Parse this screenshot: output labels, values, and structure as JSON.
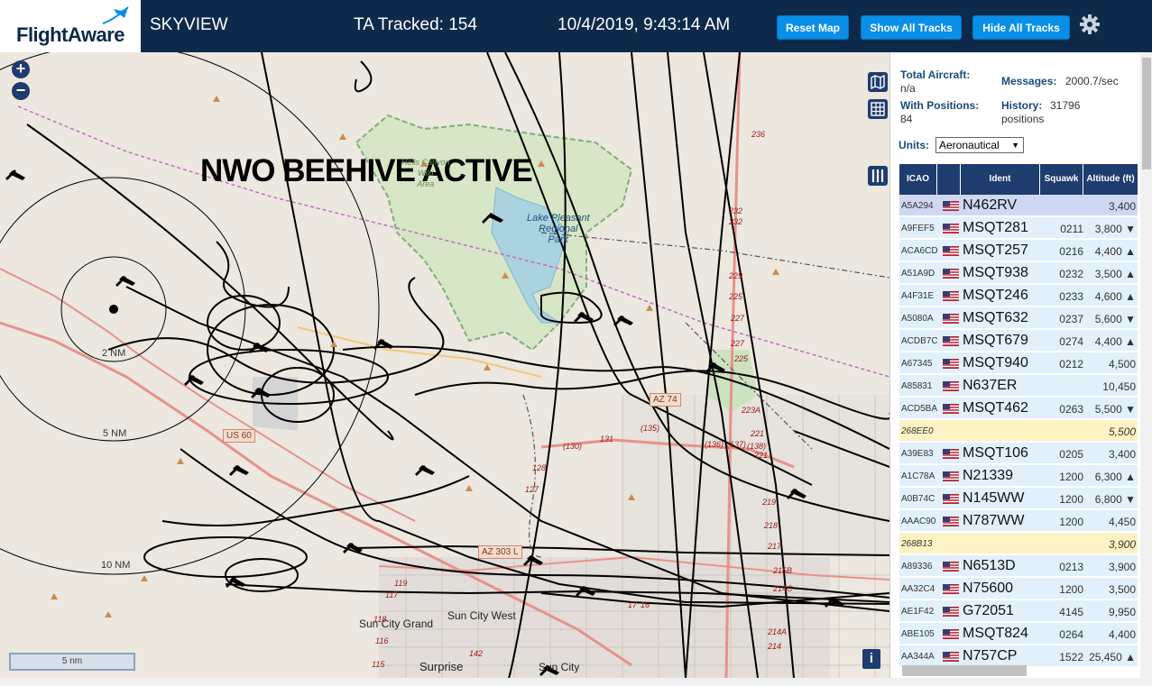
{
  "header": {
    "logo": "FlightAware",
    "app_name": "SKYVIEW",
    "tracked": "TA Tracked: 154",
    "datetime": "10/4/2019, 9:43:14 AM",
    "reset_map": "Reset Map",
    "show_all_tracks": "Show All Tracks",
    "hide_all_tracks": "Hide All Tracks"
  },
  "map": {
    "overlay_title": "NWO BEEHIVE ACTIVE",
    "ring_labels": [
      "2 NM",
      "5 NM",
      "10 NM"
    ],
    "scale_label": "5 nm",
    "lake": "Lake Pleasant\nRegional\nPark",
    "wildlife": "Hells Canyon\nWild\nArea",
    "towns": {
      "sun_city_grand": "Sun City Grand",
      "sun_city_west": "Sun City West",
      "surprise": "Surprise",
      "sun_city": "Sun City"
    },
    "shields": {
      "us60": "US 60",
      "az74": "AZ 74",
      "az303": "AZ 303 L"
    },
    "route_numbers": [
      "236",
      "232",
      "232",
      "229",
      "225",
      "227",
      "227",
      "225",
      "223A",
      "221",
      "221",
      "219",
      "218",
      "217",
      "215B",
      "214C",
      "214A",
      "214",
      "(130)",
      "131",
      "(135)",
      "(136)",
      "(137)",
      "(138)",
      "128",
      "127",
      "119",
      "117",
      "116",
      "118",
      "115",
      "142",
      "17",
      "16"
    ],
    "info_label": "i"
  },
  "sidebar": {
    "total_aircraft_label": "Total Aircraft:",
    "total_aircraft_value": "n/a",
    "messages_label": "Messages:",
    "messages_value": "2000.7/sec",
    "with_positions_label": "With Positions:",
    "with_positions_value": "84",
    "history_label": "History:",
    "history_value": "31796",
    "history_unit": "positions",
    "units_label": "Units:",
    "units_value": "Aeronautical",
    "columns": [
      "ICAO",
      "",
      "Ident",
      "Squawk",
      "Altitude (ft)"
    ],
    "rows": [
      {
        "icao": "A5A294",
        "ident": "N462RV",
        "squawk": "",
        "alt": "3,400",
        "kind": "sel"
      },
      {
        "icao": "A9FEF5",
        "ident": "MSQT281",
        "squawk": "0211",
        "alt": "3,800 ▼",
        "kind": ""
      },
      {
        "icao": "ACA6CD",
        "ident": "MSQT257",
        "squawk": "0216",
        "alt": "4,400 ▲",
        "kind": ""
      },
      {
        "icao": "A51A9D",
        "ident": "MSQT938",
        "squawk": "0232",
        "alt": "3,500 ▲",
        "kind": ""
      },
      {
        "icao": "A4F31E",
        "ident": "MSQT246",
        "squawk": "0233",
        "alt": "4,600 ▲",
        "kind": ""
      },
      {
        "icao": "A5080A",
        "ident": "MSQT632",
        "squawk": "0237",
        "alt": "5,600 ▼",
        "kind": ""
      },
      {
        "icao": "ACDB7C",
        "ident": "MSQT679",
        "squawk": "0274",
        "alt": "4,400 ▲",
        "kind": ""
      },
      {
        "icao": "A67345",
        "ident": "MSQT940",
        "squawk": "0212",
        "alt": "4,500",
        "kind": ""
      },
      {
        "icao": "A85831",
        "ident": "N637ER",
        "squawk": "",
        "alt": "10,450",
        "kind": ""
      },
      {
        "icao": "ACD5BA",
        "ident": "MSQT462",
        "squawk": "0263",
        "alt": "5,500 ▼",
        "kind": ""
      },
      {
        "icao": "268EE0",
        "ident": "",
        "squawk": "",
        "alt": "5,500",
        "kind": "nopos"
      },
      {
        "icao": "A39E83",
        "ident": "MSQT106",
        "squawk": "0205",
        "alt": "3,400",
        "kind": ""
      },
      {
        "icao": "A1C78A",
        "ident": "N21339",
        "squawk": "1200",
        "alt": "6,300 ▲",
        "kind": ""
      },
      {
        "icao": "A0B74C",
        "ident": "N145WW",
        "squawk": "1200",
        "alt": "6,800 ▼",
        "kind": ""
      },
      {
        "icao": "AAAC90",
        "ident": "N787WW",
        "squawk": "1200",
        "alt": "4,450",
        "kind": ""
      },
      {
        "icao": "268B13",
        "ident": "",
        "squawk": "",
        "alt": "3,900",
        "kind": "nopos"
      },
      {
        "icao": "A89336",
        "ident": "N6513D",
        "squawk": "0213",
        "alt": "3,900",
        "kind": ""
      },
      {
        "icao": "AA32C4",
        "ident": "N75600",
        "squawk": "1200",
        "alt": "3,500",
        "kind": ""
      },
      {
        "icao": "AE1F42",
        "ident": "G72051",
        "squawk": "4145",
        "alt": "9,950",
        "kind": ""
      },
      {
        "icao": "ABE105",
        "ident": "MSQT824",
        "squawk": "0264",
        "alt": "4,400",
        "kind": ""
      },
      {
        "icao": "AA344A",
        "ident": "N757CP",
        "squawk": "1522",
        "alt": "25,450 ▲",
        "kind": ""
      }
    ]
  },
  "colors": {
    "header_bg": "#0d2a4a",
    "button": "#0a8fe6",
    "table_head": "#1e3c6e",
    "row": "#e1f0fa",
    "row_selected": "#cfd8f2",
    "row_no_position": "#fdf2c3"
  },
  "icons": [
    "plane-logo-icon",
    "gear-icon",
    "zoom-in-icon",
    "zoom-out-icon",
    "map-layers-icon",
    "grid-icon",
    "columns-icon",
    "info-icon",
    "flag-us-icon",
    "aircraft-icon"
  ]
}
